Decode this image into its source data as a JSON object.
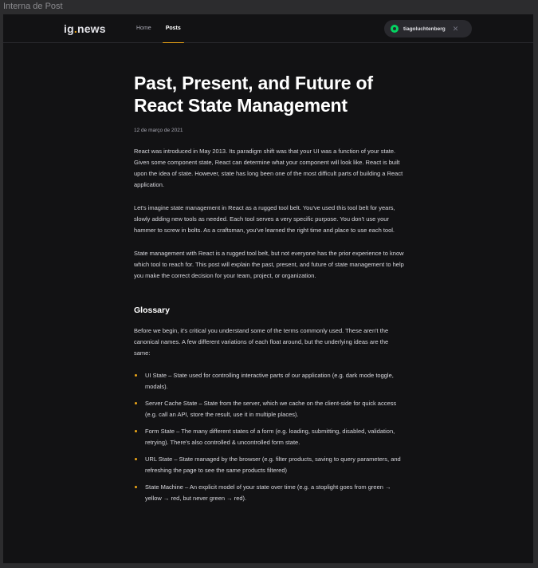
{
  "window": {
    "title": "Interna de Post"
  },
  "header": {
    "logo_main": "ig",
    "logo_dot": ".",
    "logo_suffix": "news",
    "nav": [
      {
        "label": "Home",
        "active": false
      },
      {
        "label": "Posts",
        "active": true
      }
    ],
    "user_button": {
      "username": "tiagoluchtenberg",
      "icon": "github-icon",
      "close_icon": "close-icon",
      "close_glyph": "✕"
    }
  },
  "post": {
    "title": "Past, Present, and Future of React State Management",
    "date": "12 de março de 2021",
    "paragraphs": [
      "React was introduced in May 2013. Its paradigm shift was that your UI was a function of your state. Given some component state, React can determine what your component will look like. React is built upon the idea of state. However, state has long been one of the most difficult parts of building a React application.",
      "Let's imagine state management in React as a rugged tool belt. You've used this tool belt for years, slowly adding new tools as needed. Each tool serves a very specific purpose. You don't use your hammer to screw in bolts. As a craftsman, you've learned the right time and place to use each tool.",
      "State management with React is a rugged tool belt, but not everyone has the prior experience to know which tool to reach for. This post will explain the past, present, and future of state management to help you make the correct decision for your team, project, or organization."
    ],
    "section_heading": "Glossary",
    "section_intro": "Before we begin, it's critical you understand some of the terms commonly used. These aren't the canonical names. A few different variations of each float around, but the underlying ideas are the same:",
    "bullets": [
      "UI State – State used for controlling interactive parts of our application (e.g. dark mode toggle, modals).",
      "Server Cache State – State from the server, which we cache on the client-side for quick access (e.g. call an API, store the result, use it in multiple places).",
      "Form State – The many different states of a form (e.g. loading, submitting, disabled, validation, retrying). There's also controlled & uncontrolled form state.",
      "URL State – State managed by the browser (e.g. filter products, saving to query parameters, and refreshing the page to see the same products filtered)",
      "State Machine – An explicit model of your state over time (e.g. a stoplight goes from green → yellow → red, but never green → red)."
    ]
  },
  "colors": {
    "accent": "#eba417",
    "background": "#121214",
    "github": "#04d361"
  }
}
